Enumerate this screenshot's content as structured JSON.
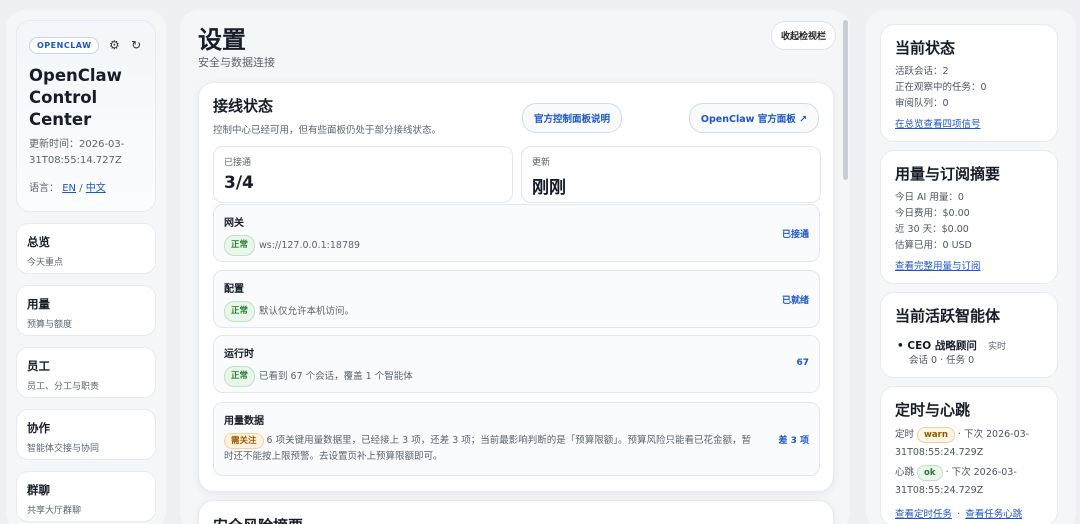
{
  "sidebar": {
    "brand_pill": "OPENCLAW",
    "settings_icon": "gear-icon",
    "refresh_icon": "refresh-icon",
    "title": "OpenClaw Control Center",
    "updated_label": "更新时间：2026-03-31T08:55:14.727Z",
    "lang_label": "语言：",
    "lang_en": "EN",
    "lang_sep": "/",
    "lang_zh": "中文",
    "items": [
      {
        "label": "总览",
        "sub": "今天重点"
      },
      {
        "label": "用量",
        "sub": "预算与额度"
      },
      {
        "label": "员工",
        "sub": "员工、分工与职责"
      },
      {
        "label": "协作",
        "sub": "智能体交接与协同"
      },
      {
        "label": "群聊",
        "sub": "共享大厅群聊"
      }
    ]
  },
  "main": {
    "title": "设置",
    "subtitle": "安全与数据连接",
    "collapse_label": "收起检视栏",
    "panel": {
      "title": "接线状态",
      "subtitle": "控制中心已经可用，但有些面板仍处于部分接线状态。",
      "doc_button": "官方控制面板说明",
      "official_button": "OpenClaw 官方面板 ↗",
      "stats": [
        {
          "label": "已接通",
          "value": "3/4"
        },
        {
          "label": "更新",
          "value": "刚刚"
        }
      ],
      "rows": [
        {
          "title": "网关",
          "badge": "正常",
          "text": "ws://127.0.0.1:18789",
          "right": "已接通"
        },
        {
          "title": "配置",
          "badge": "正常",
          "text": "默认仅允许本机访问。",
          "right": "已就绪"
        },
        {
          "title": "运行时",
          "badge": "正常",
          "text": "已看到 67 个会话，覆盖 1 个智能体",
          "right": "67"
        },
        {
          "title": "用量数据",
          "badge": "需关注",
          "text": "6 项关键用量数据里，已经接上 3 项，还差 3 项；当前最影响判断的是「预算限额」。预算风险只能看已花金额，暂时还不能按上限预警。去设置页补上预算限额即可。",
          "right": "差 3 项"
        }
      ]
    },
    "next_panel_title": "安全风险摘要"
  },
  "right": {
    "status": {
      "title": "当前状态",
      "lines": [
        "活跃会话：2",
        "正在观察中的任务：0",
        "审阅队列：0"
      ],
      "link": "在总览查看四项信号"
    },
    "usage": {
      "title": "用量与订阅摘要",
      "lines": [
        "今日 AI 用量：0",
        "今日费用：$0.00",
        "近 30 天：$0.00",
        "估算已用：0 USD"
      ],
      "link": "查看完整用量与订阅"
    },
    "agents": {
      "title": "当前活跃智能体",
      "name": "CEO 战略顾问",
      "tag": "实时",
      "meta": "会话 0 · 任务 0"
    },
    "cron": {
      "title": "定时与心跳",
      "cron_label": "定时",
      "cron_status": "warn",
      "cron_next": "· 下次 2026-03-31T08:55:24.729Z",
      "heart_label": "心跳",
      "heart_status": "ok",
      "heart_next": "· 下次 2026-03-31T08:55:24.729Z",
      "link1": "查看定时任务",
      "link_sep": "·",
      "link2": "查看任务心跳"
    }
  }
}
